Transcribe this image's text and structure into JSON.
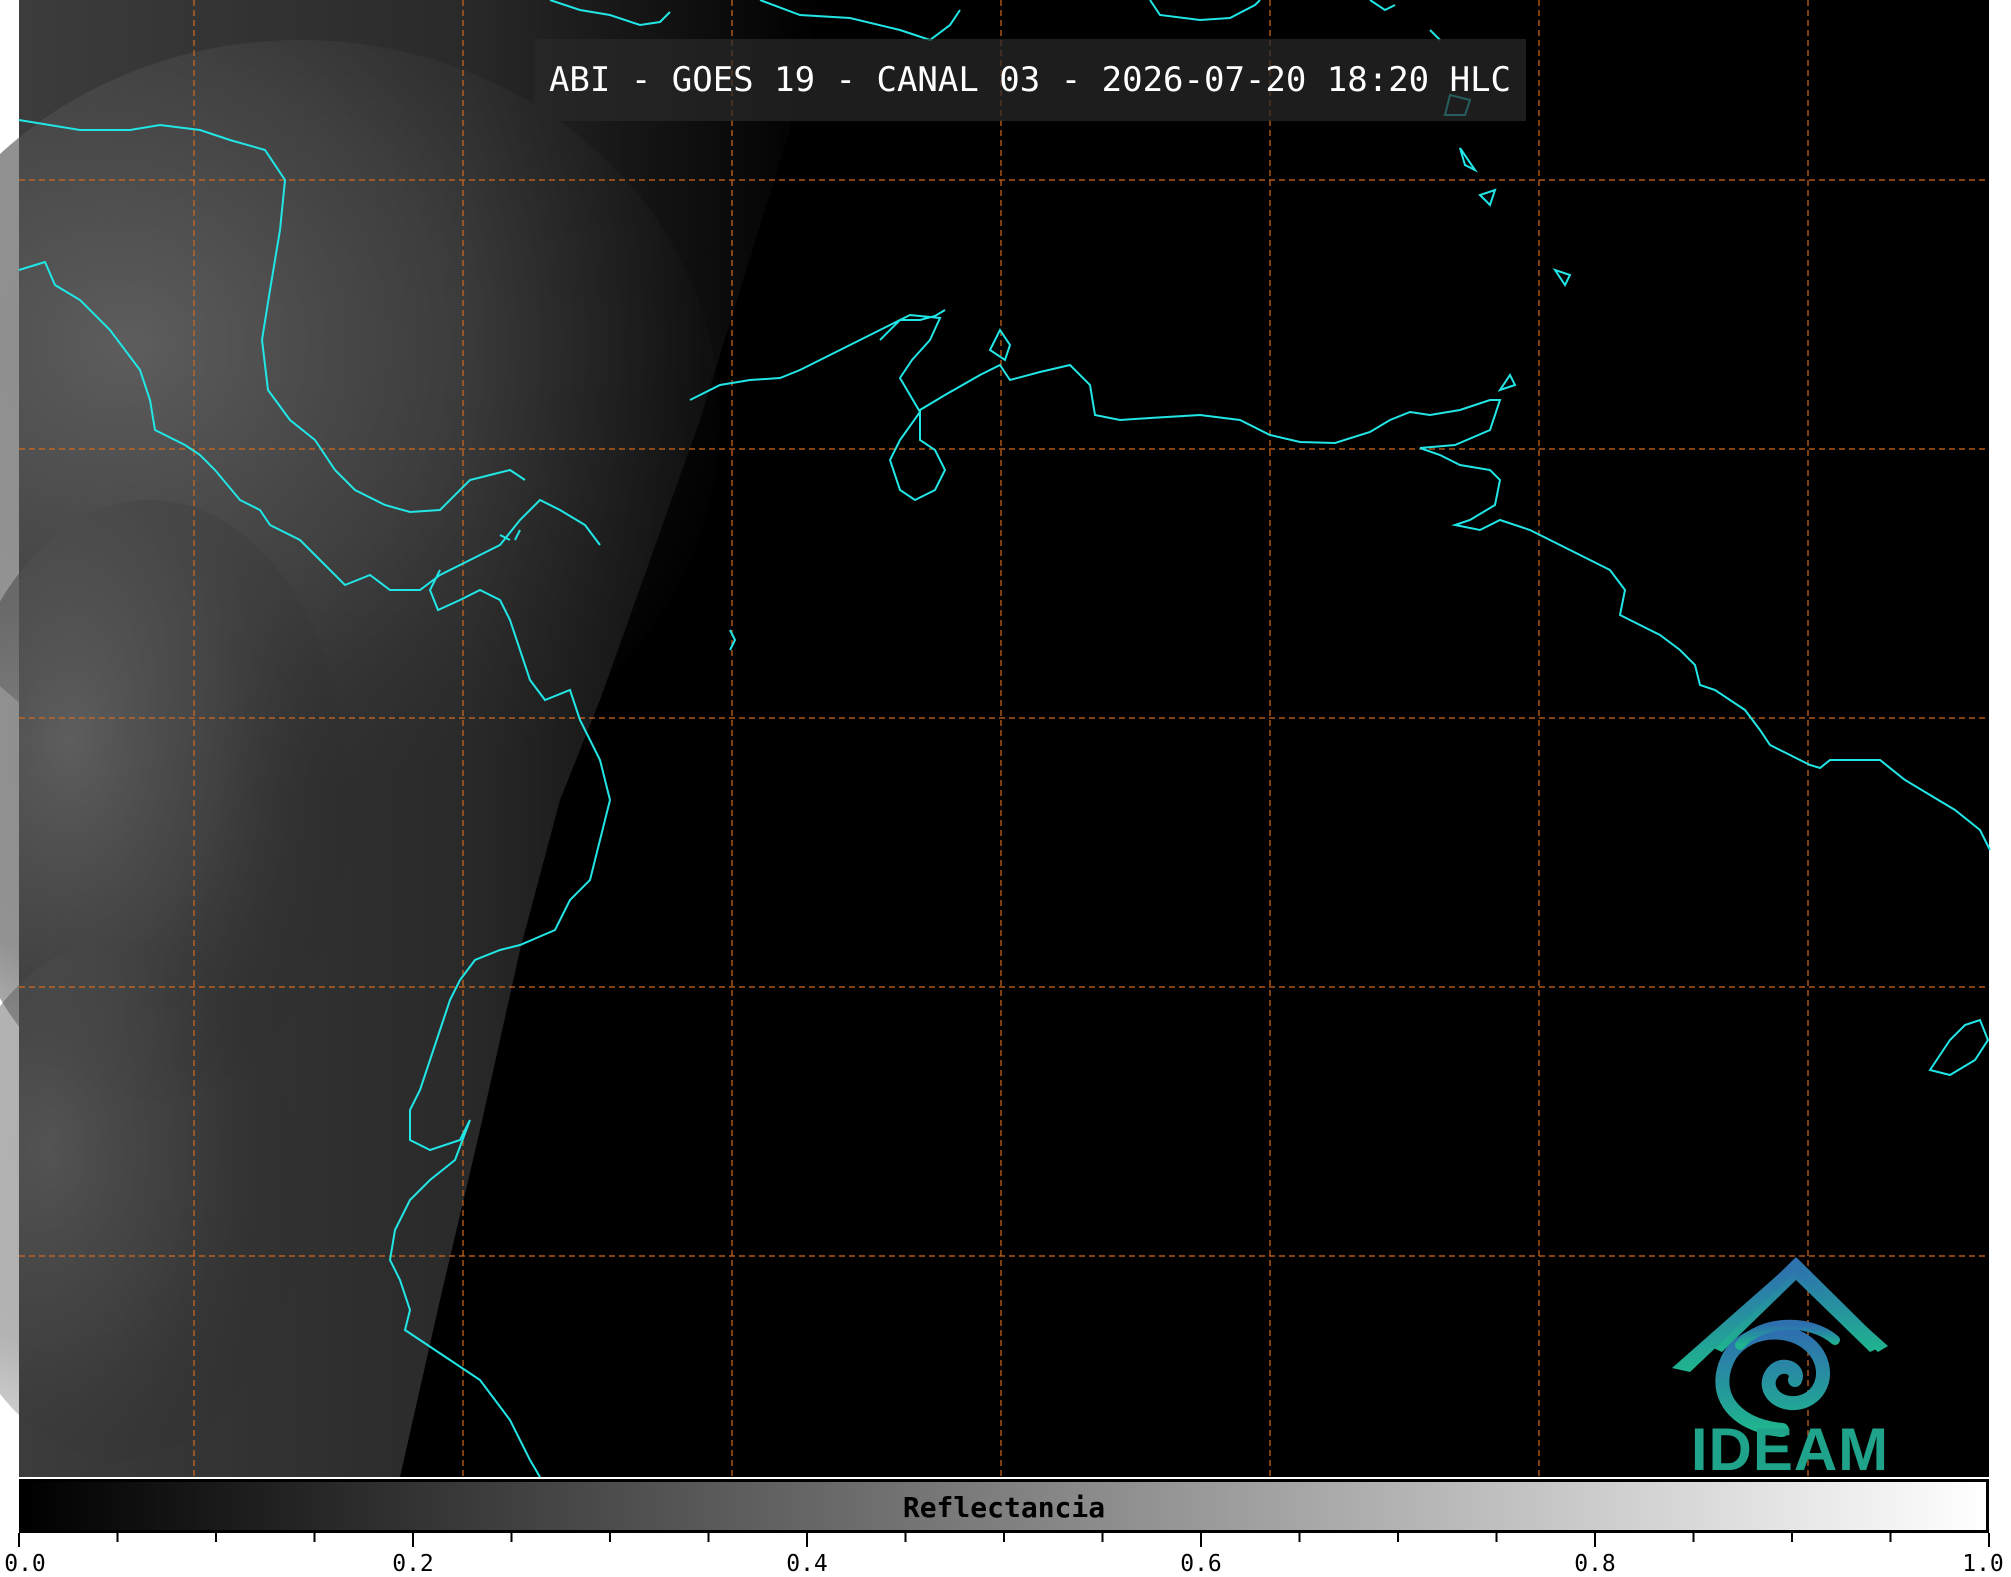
{
  "title": "ABI - GOES 19 - CANAL 03 - 2026-07-20 18:20 HLC",
  "logo": {
    "text": "IDEAM",
    "color": "#1fa38a",
    "icon": "ideam-mountain-spiral-icon"
  },
  "colorbar": {
    "label": "Reflectancia",
    "min": 0.0,
    "max": 1.0,
    "colors": [
      "#000000",
      "#ffffff"
    ],
    "tick_labels": [
      "0.0",
      "0.2",
      "0.4",
      "0.6",
      "0.8",
      "1.0"
    ],
    "tick_values": [
      0.0,
      0.2,
      0.4,
      0.6,
      0.8,
      1.0
    ],
    "minor_tick_step": 0.05
  },
  "map": {
    "background": "#000000",
    "coastline_color": "#22e6e6",
    "gridline_color": "#d2691e",
    "gridline_style": "dashed"
  }
}
